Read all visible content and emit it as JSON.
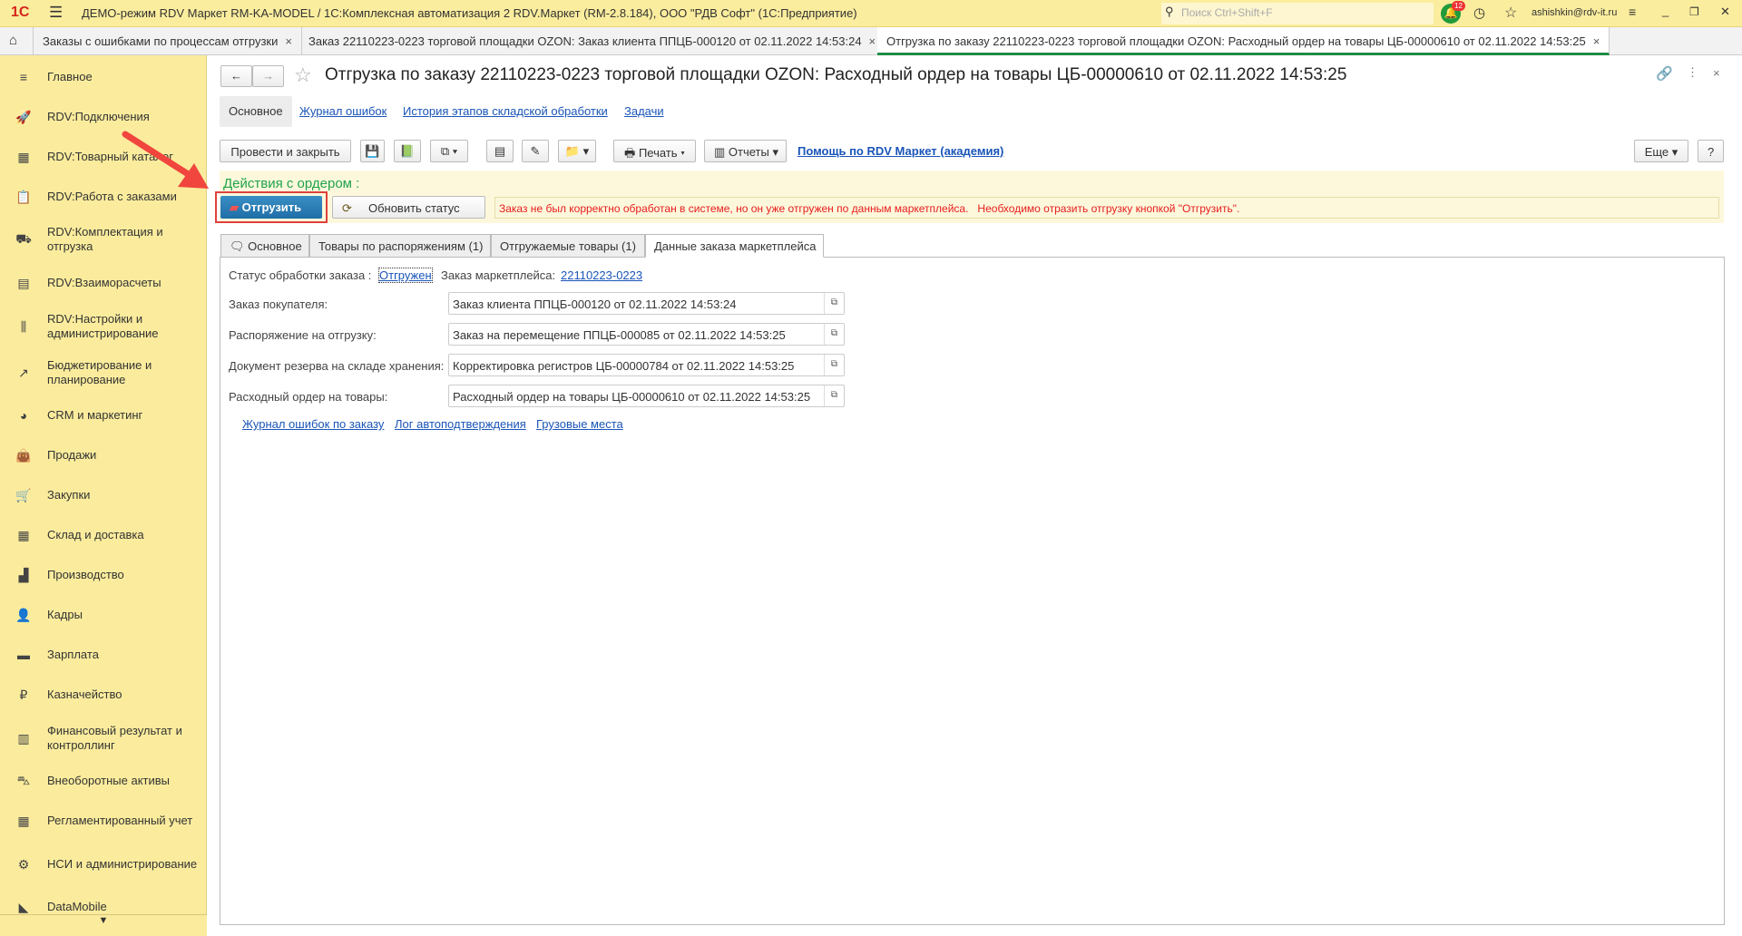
{
  "window": {
    "title": "ДЕМО-режим RDV Маркет RM-KA-MODEL / 1С:Комплексная автоматизация 2 RDV.Маркет (RM-2.8.184), ООО \"РДВ Софт\"  (1С:Предприятие)",
    "search_placeholder": "Поиск Ctrl+Shift+F",
    "notification_count": "12",
    "user": "ashishkin@rdv-it.ru",
    "logo": "1С"
  },
  "tabs": [
    {
      "label": "Заказы с ошибками по процессам отгрузки"
    },
    {
      "label": "Заказ 22110223-0223 торговой площадки OZON: Заказ клиента ППЦБ-000120 от 02.11.2022 14:53:24"
    },
    {
      "label": "Отгрузка по заказу 22110223-0223 торговой площадки OZON: Расходный ордер на товары ЦБ-00000610 от 02.11.2022 14:53:25"
    }
  ],
  "sidebar": [
    {
      "label": "Главное",
      "icon": "≡"
    },
    {
      "label": "RDV:Подключения",
      "icon": "🚀"
    },
    {
      "label": "RDV:Товарный каталог",
      "icon": "▦"
    },
    {
      "label": "RDV:Работа с заказами",
      "icon": "📋"
    },
    {
      "label": "RDV:Комплектация и отгрузка",
      "icon": "⛟"
    },
    {
      "label": "RDV:Взаиморасчеты",
      "icon": "▤"
    },
    {
      "label": "RDV:Настройки и администрирование",
      "icon": "⫼"
    },
    {
      "label": "Бюджетирование и планирование",
      "icon": "↗"
    },
    {
      "label": "CRM и маркетинг",
      "icon": "◕"
    },
    {
      "label": "Продажи",
      "icon": "👜"
    },
    {
      "label": "Закупки",
      "icon": "🛒"
    },
    {
      "label": "Склад и доставка",
      "icon": "▦"
    },
    {
      "label": "Производство",
      "icon": "▟"
    },
    {
      "label": "Кадры",
      "icon": "👤"
    },
    {
      "label": "Зарплата",
      "icon": "▬"
    },
    {
      "label": "Казначейство",
      "icon": "₽"
    },
    {
      "label": "Финансовый результат и контроллинг",
      "icon": "▥"
    },
    {
      "label": "Внеоборотные активы",
      "icon": "⛍"
    },
    {
      "label": "Регламентированный учет",
      "icon": "▦"
    },
    {
      "label": "НСИ и администрирование",
      "icon": "⚙"
    },
    {
      "label": "DataMobile",
      "icon": "◣"
    }
  ],
  "form": {
    "title": "Отгрузка по заказу 22110223-0223 торговой площадки OZON: Расходный ордер на товары ЦБ-00000610 от 02.11.2022 14:53:25",
    "nav_tabs": [
      "Основное",
      "Журнал ошибок",
      "История этапов складской обработки",
      "Задачи"
    ],
    "toolbar": {
      "post_close": "Провести и закрыть",
      "print": "Печать",
      "reports": "Отчеты",
      "help_link": "Помощь по RDV Маркет (академия)",
      "more": "Еще",
      "question": "?"
    },
    "actions": {
      "title": "Действия с ордером :",
      "ship": "Отгрузить",
      "refresh": "Обновить статус",
      "message": "Заказ не был корректно обработан в системе, но он уже отгружен по данным маркетплейса.   Необходимо отразить отгрузку кнопкой \"Отгрузить\"."
    },
    "inner_tabs": [
      "Основное",
      "Товары по распоряжениям (1)",
      "Отгружаемые товары (1)",
      "Данные заказа маркетплейса"
    ],
    "status_label": "Статус обработки заказа :",
    "status_value": "Отгружен",
    "mp_label": "Заказ маркетплейса:",
    "mp_value": "22110223-0223",
    "fields": [
      {
        "label": "Заказ покупателя:",
        "value": "Заказ клиента ППЦБ-000120 от 02.11.2022 14:53:24"
      },
      {
        "label": "Распоряжение на отгрузку:",
        "value": "Заказ на перемещение ППЦБ-000085 от 02.11.2022 14:53:25"
      },
      {
        "label": "Документ резерва на складе хранения:",
        "value": "Корректировка регистров ЦБ-00000784 от 02.11.2022 14:53:25"
      },
      {
        "label": "Расходный ордер на товары:",
        "value": "Расходный ордер на товары ЦБ-00000610 от 02.11.2022 14:53:25"
      }
    ],
    "links": [
      "Журнал ошибок по заказу",
      "Лог автоподтверждения",
      "Грузовые места"
    ]
  }
}
